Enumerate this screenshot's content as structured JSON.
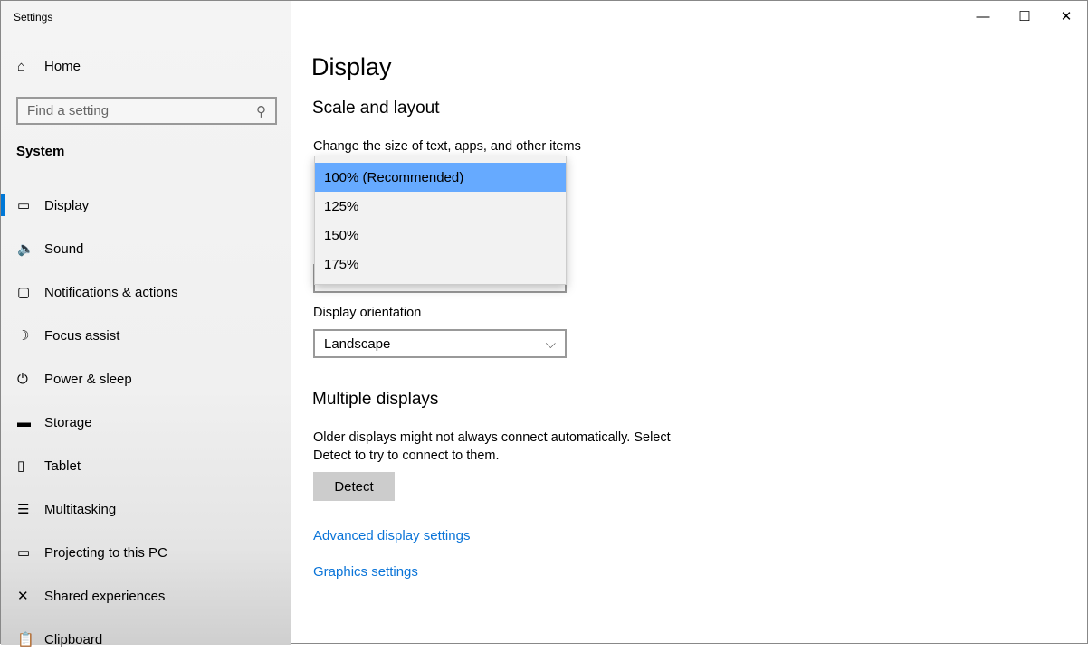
{
  "window": {
    "title": "Settings",
    "minimize": "—",
    "maximize": "☐",
    "close": "✕"
  },
  "sidebar": {
    "home": "Home",
    "search_placeholder": "Find a setting",
    "section": "System",
    "items": [
      {
        "label": "Display",
        "icon": "▭"
      },
      {
        "label": "Sound",
        "icon": "🔈"
      },
      {
        "label": "Notifications & actions",
        "icon": "▢"
      },
      {
        "label": "Focus assist",
        "icon": "☽"
      },
      {
        "label": "Power & sleep",
        "icon": "⏻"
      },
      {
        "label": "Storage",
        "icon": "▬"
      },
      {
        "label": "Tablet",
        "icon": "▯"
      },
      {
        "label": "Multitasking",
        "icon": "☰"
      },
      {
        "label": "Projecting to this PC",
        "icon": "▭"
      },
      {
        "label": "Shared experiences",
        "icon": "✕"
      },
      {
        "label": "Clipboard",
        "icon": "📋"
      }
    ]
  },
  "main": {
    "title": "Display",
    "scale_heading": "Scale and layout",
    "scale_label": "Change the size of text, apps, and other items",
    "scale_options": [
      "100% (Recommended)",
      "125%",
      "150%",
      "175%"
    ],
    "orientation_label": "Display orientation",
    "orientation_value": "Landscape",
    "multi_heading": "Multiple displays",
    "multi_text_1": "Older displays might not always connect automatically. Select",
    "multi_text_2": "Detect to try to connect to them.",
    "detect": "Detect",
    "link_advanced": "Advanced display settings",
    "link_graphics": "Graphics settings"
  }
}
